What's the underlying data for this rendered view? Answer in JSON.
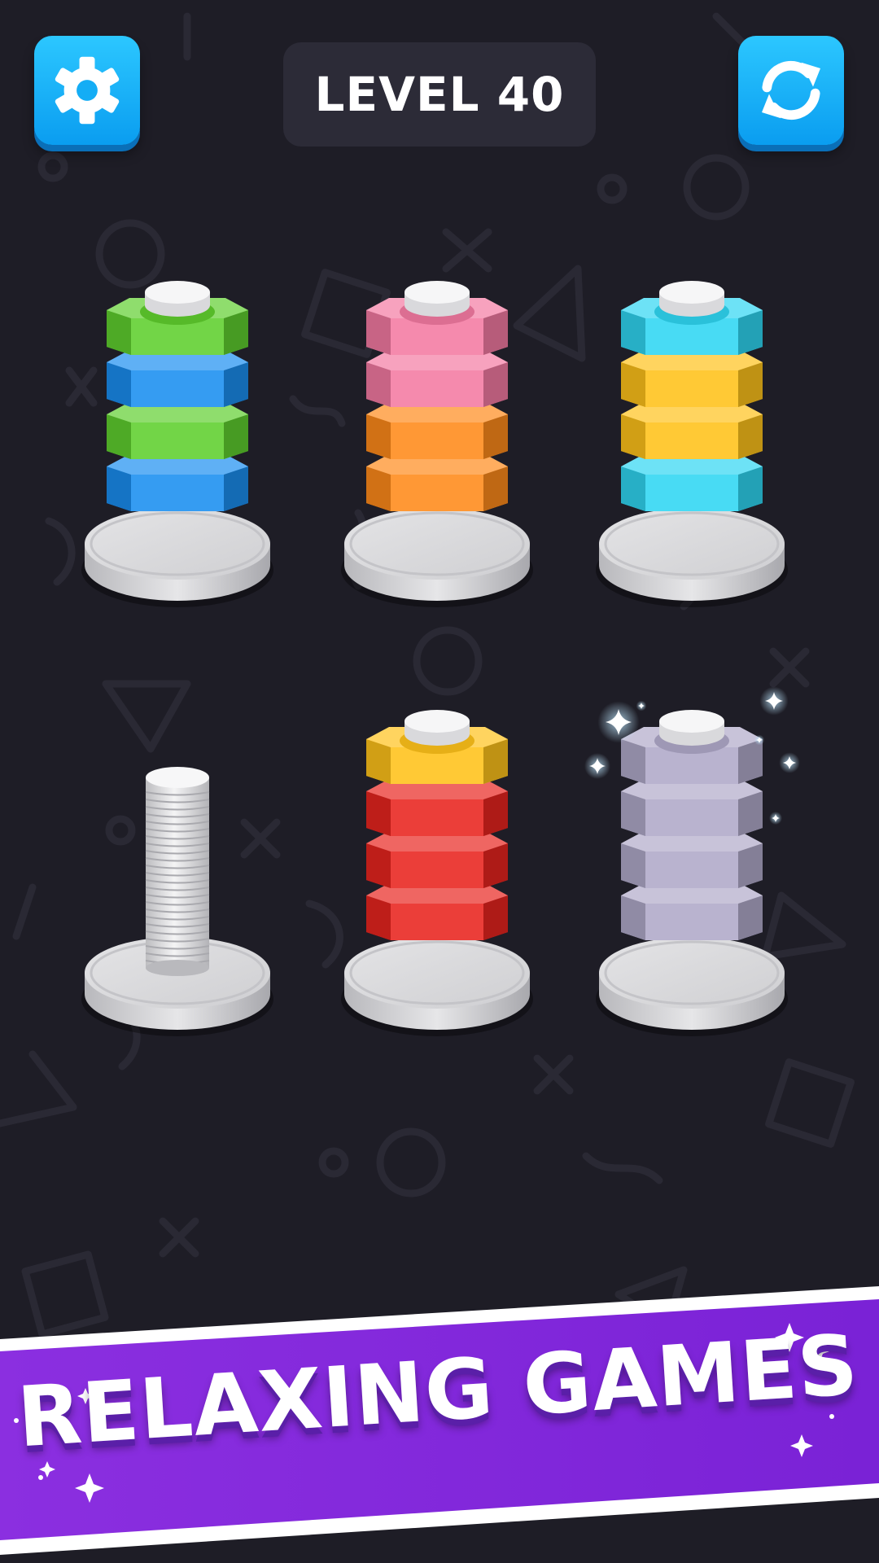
{
  "header": {
    "level_label": "LEVEL 40",
    "settings_icon": "gear-icon",
    "restart_icon": "refresh-icon"
  },
  "pegs": [
    {
      "id": 1,
      "nuts_top_to_bottom": [
        "green",
        "blue",
        "green",
        "blue"
      ],
      "completed": false
    },
    {
      "id": 2,
      "nuts_top_to_bottom": [
        "pink",
        "pink",
        "orange",
        "orange"
      ],
      "completed": false
    },
    {
      "id": 3,
      "nuts_top_to_bottom": [
        "cyan",
        "yellow",
        "yellow",
        "cyan"
      ],
      "completed": false
    },
    {
      "id": 4,
      "nuts_top_to_bottom": [],
      "completed": false
    },
    {
      "id": 5,
      "nuts_top_to_bottom": [
        "yellow",
        "red",
        "red",
        "red"
      ],
      "completed": false
    },
    {
      "id": 6,
      "nuts_top_to_bottom": [
        "lavender",
        "lavender",
        "lavender",
        "lavender"
      ],
      "completed": true
    }
  ],
  "colors": {
    "background": "#1e1d26",
    "button_blue": "#14b2f8",
    "banner_purple": "#8a2be2",
    "green": "#5fcf2e",
    "blue": "#1a8ef0",
    "pink": "#f47aa2",
    "orange": "#ff8a1a",
    "cyan": "#2fd6f2",
    "yellow": "#ffc21a",
    "red": "#e8241e",
    "lavender": "#b0a9c9"
  },
  "banner": {
    "text": "RELAXING GAMES"
  }
}
